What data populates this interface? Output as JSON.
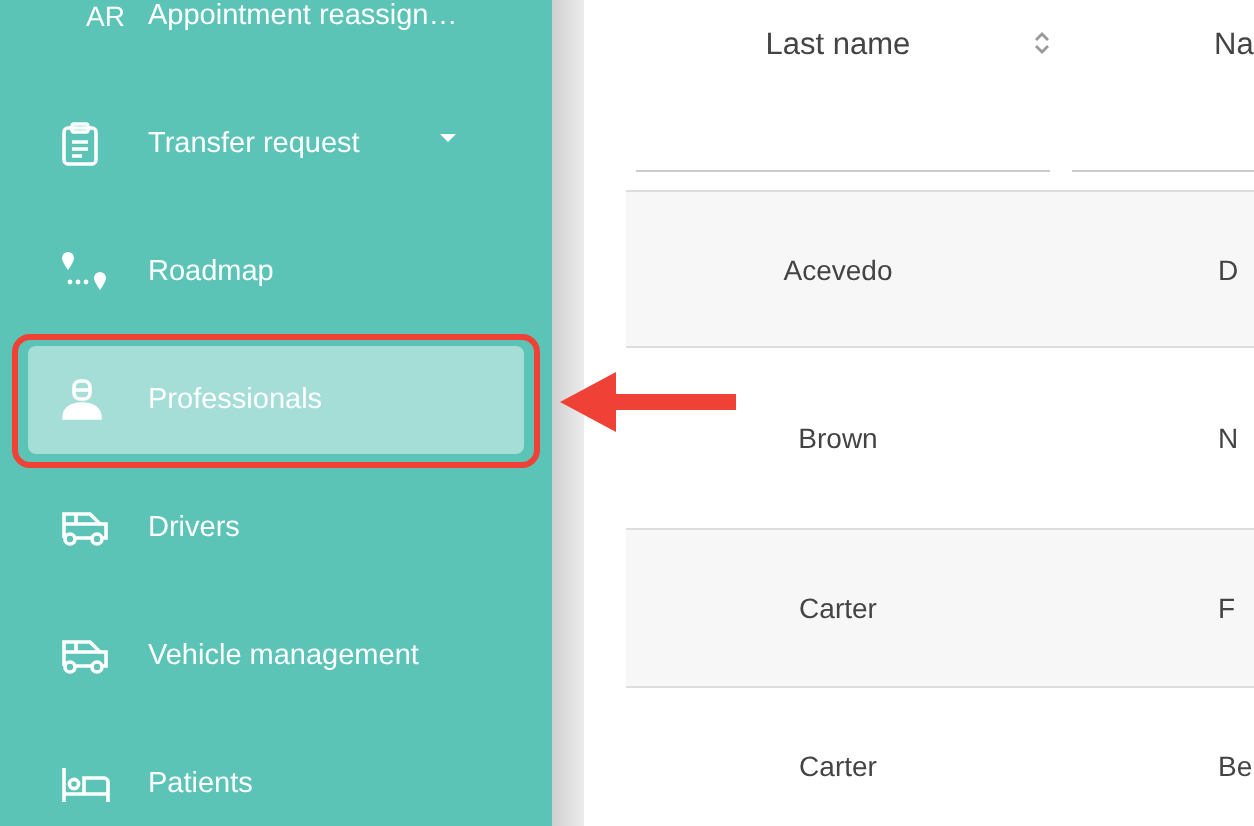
{
  "sidebar": {
    "items": [
      {
        "kind": "abbr",
        "abbr": "AR",
        "label": "Appointment reassign…",
        "expandable": false,
        "selected": false,
        "annotated": false
      },
      {
        "kind": "clipboard",
        "label": "Transfer request",
        "expandable": true,
        "selected": false,
        "annotated": false
      },
      {
        "kind": "route",
        "label": "Roadmap",
        "expandable": false,
        "selected": false,
        "annotated": false
      },
      {
        "kind": "person",
        "label": "Professionals",
        "expandable": false,
        "selected": true,
        "annotated": true
      },
      {
        "kind": "van",
        "label": "Drivers",
        "expandable": false,
        "selected": false,
        "annotated": false
      },
      {
        "kind": "van",
        "label": "Vehicle management",
        "expandable": false,
        "selected": false,
        "annotated": false
      },
      {
        "kind": "bed",
        "label": "Patients",
        "expandable": false,
        "selected": false,
        "annotated": false
      }
    ]
  },
  "table": {
    "columns": [
      {
        "label": "Last name",
        "sortable": true
      },
      {
        "label": "Na",
        "sortable": false
      }
    ],
    "rows": [
      [
        "Acevedo",
        "D"
      ],
      [
        "Brown",
        "N"
      ],
      [
        "Carter",
        "F"
      ],
      [
        "Carter",
        "Be"
      ]
    ]
  }
}
